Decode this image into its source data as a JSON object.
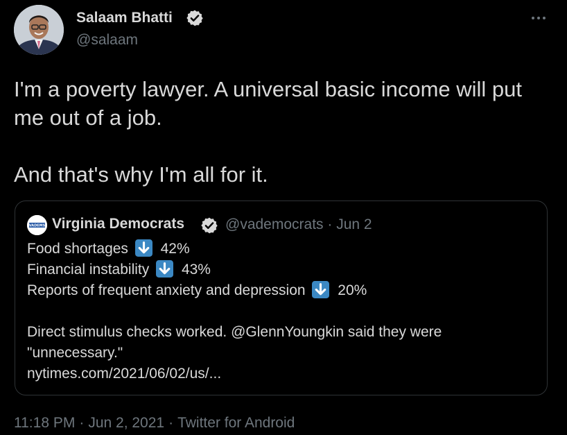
{
  "author": {
    "display_name": "Salaam Bhatti",
    "handle": "@salaam",
    "verified": true,
    "avatar_icon": "person-avatar"
  },
  "tweet": {
    "lines": [
      "I'm a poverty lawyer. A universal basic income will put me out of a job.",
      "And that's why I'm all for it."
    ]
  },
  "quoted": {
    "display_name": "Virginia Democrats",
    "handle": "@vademocrats",
    "date": "Jun 2",
    "meta_separator": "·",
    "avatar_text": "VADEMS",
    "verified": true,
    "stats": [
      {
        "label": "Food shortages",
        "icon": "down-arrow-emoji",
        "value": "42%"
      },
      {
        "label": "Financial instability",
        "icon": "down-arrow-emoji",
        "value": "43%"
      },
      {
        "label": "Reports of frequent anxiety and depression",
        "icon": "down-arrow-emoji",
        "value": "20%"
      }
    ],
    "text": "Direct stimulus checks worked. @GlennYoungkin said they were",
    "text_2": "\"unnecessary.\"",
    "link": "nytimes.com/2021/06/02/us/..."
  },
  "footer": {
    "time": "11:18 PM",
    "date": "Jun 2, 2021",
    "source": "Twitter for Android",
    "separator": "·"
  },
  "colors": {
    "background": "#000000",
    "text": "#d9d9d9",
    "muted": "#6e767d",
    "border": "#2f3336",
    "emoji_blue": "#3b88c3"
  }
}
